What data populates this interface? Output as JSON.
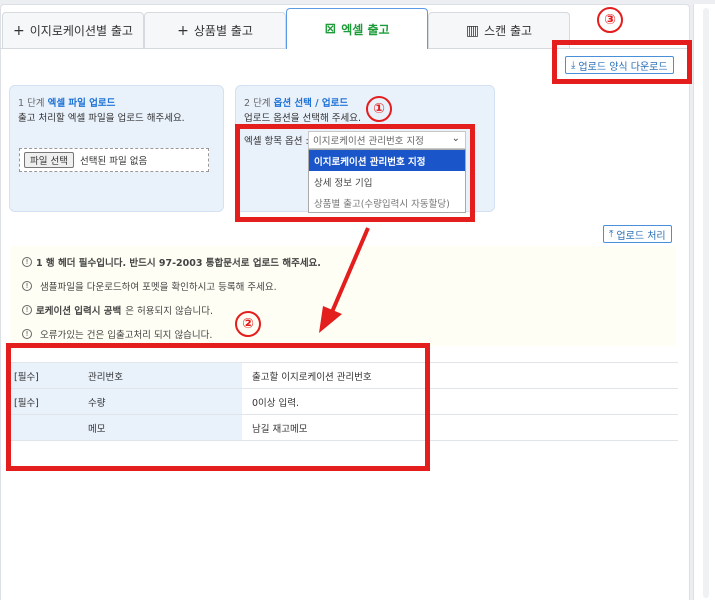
{
  "tabs": [
    {
      "icon": "+",
      "label": "이지로케이션별 출고"
    },
    {
      "icon": "+",
      "label": "상품별 출고"
    },
    {
      "icon": "⊠",
      "label": "엑셀 출고"
    },
    {
      "icon": "▥",
      "label": "스캔 출고"
    }
  ],
  "buttons": {
    "download_form": "업로드 양식 다운로드",
    "upload_process": "업로드 처리"
  },
  "step1": {
    "prefix": "1 단계",
    "title": "엑셀 파일 업로드",
    "desc": "출고 처리할 엑셀 파일을 업로드 해주세요.",
    "file_button": "파일 선택",
    "file_status": "선택된 파일 없음"
  },
  "step2": {
    "prefix": "2 단계",
    "title": "옵션 선택 / 업로드",
    "desc": "업로드 옵션을 선택해 주세요.",
    "option_label": "엑셀 항목 옵션 :",
    "selected_value": "이지로케이션 관리번호 지정",
    "options": [
      "이지로케이션 관리번호 지정",
      "상세 정보 기입",
      "상품별 출고(수량입력시 자동할당)"
    ]
  },
  "notices": [
    {
      "bold": "1 행 헤더 필수입니다. 반드시 97-2003 통합문서로 업로드 해주세요.",
      "text": ""
    },
    {
      "bold": "",
      "text": "샘플파일을 다운로드하여 포멧을 확인하시고 등록해 주세요."
    },
    {
      "bold": "로케이션 입력시 공백",
      "text": "은 허용되지 않습니다."
    },
    {
      "bold": "",
      "text": "오류가있는 건은 입출고처리 되지 않습니다."
    }
  ],
  "table": [
    {
      "req": "[필수]",
      "field": "관리번호",
      "desc": "출고할 이지로케이션 관리번호"
    },
    {
      "req": "[필수]",
      "field": "수량",
      "desc": "0이상 입력."
    },
    {
      "req": "",
      "field": "메모",
      "desc": "남길 재고메모"
    }
  ],
  "annotations": {
    "badge1": "①",
    "badge2": "②",
    "badge3": "③"
  },
  "colors": {
    "accent_red": "#e41d1d",
    "active_tab_text": "#1f9c3a",
    "link_blue": "#1f73d6",
    "selected_option": "#1a56c9"
  }
}
